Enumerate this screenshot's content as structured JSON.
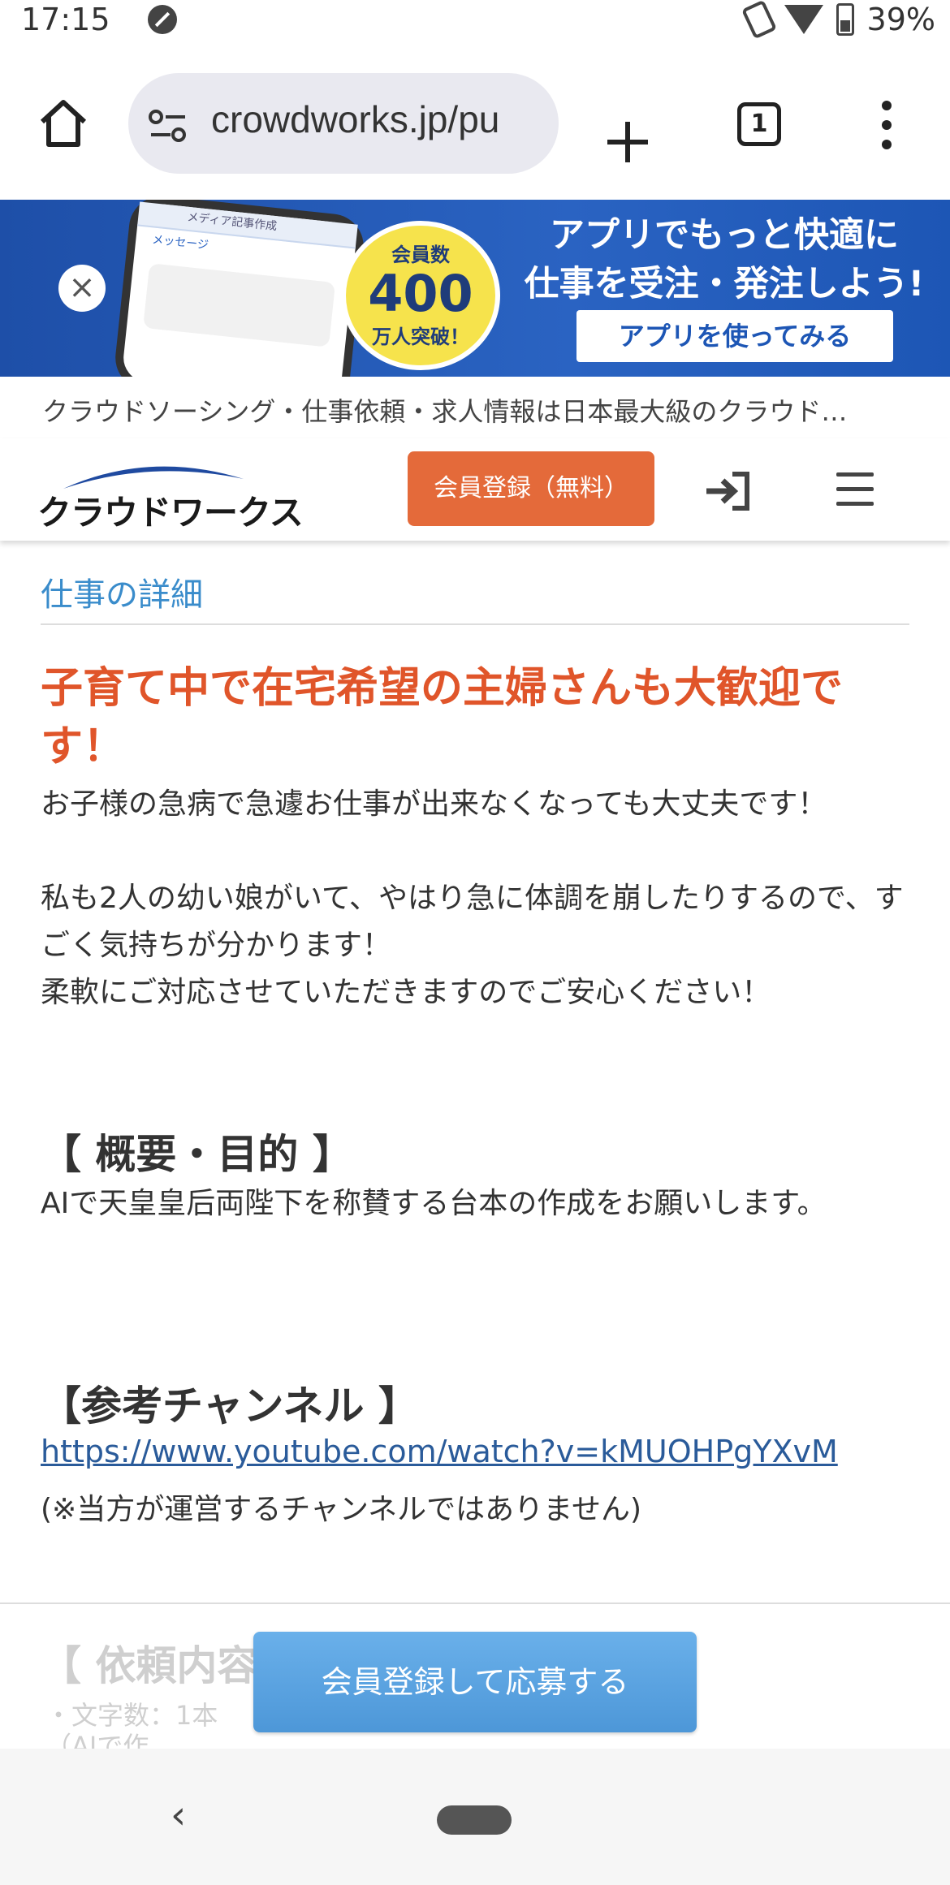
{
  "status_bar": {
    "time": "17:15",
    "battery": "39%"
  },
  "browser": {
    "url": "crowdworks.jp/pu",
    "tab_count": "1"
  },
  "banner": {
    "phone_header": "メディア記事作成",
    "phone_msg": "メッセージ",
    "badge_line1": "会員数",
    "badge_number": "400",
    "badge_line3": "万人突破！",
    "headline_line1": "アプリでもっと快適に",
    "headline_line2": "仕事を受注・発注しよう!",
    "cta": "アプリを使ってみる"
  },
  "description": "クラウドソーシング・仕事依頼・求人情報は日本最大級のクラウド…",
  "header": {
    "logo_text": "クラウドワークス",
    "register_label": "会員登録（無料）"
  },
  "content": {
    "section_title": "仕事の詳細",
    "job_title": "子育て中で在宅希望の主婦さんも大歓迎です！",
    "intro_line1": "お子様の急病で急遽お仕事が出来なくなっても大丈夫です！",
    "intro_line2": "私も2人の幼い娘がいて、やはり急に体調を崩したりするので、すごく気持ちが分かります！",
    "intro_line3": "柔軟にご対応させていただきますのでご安心ください！",
    "overview_heading": "【 概要・目的 】",
    "overview_text": "AIで天皇皇后両陛下を称賛する台本の作成をお願いします。",
    "channel_heading": "【参考チャンネル 】",
    "channel_link": "https://www.youtube.com/watch?v=kMUOHPgYXvM",
    "channel_note": "(※当方が運営するチャンネルではありません)",
    "faded_heading": "【 依頼内容",
    "faded_line": "・文字数：1本",
    "faded_line2": "（AIで作"
  },
  "bottom": {
    "apply_label": "会員登録して応募する"
  }
}
